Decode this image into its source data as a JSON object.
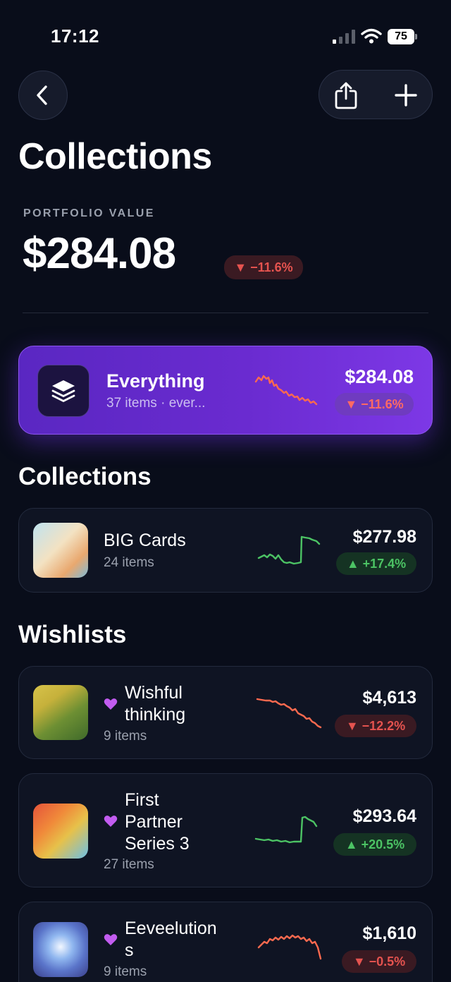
{
  "status_bar": {
    "time": "17:12",
    "battery": "75"
  },
  "header": {
    "title": "Collections"
  },
  "portfolio": {
    "label": "PORTFOLIO VALUE",
    "value": "$284.08",
    "change": "▼ −11.6%"
  },
  "everything": {
    "name": "Everything",
    "subtitle": "37 items · ever...",
    "value": "$284.08",
    "change": "▼ −11.6%"
  },
  "collections_section": {
    "title": "Collections",
    "items": [
      {
        "name": "BIG Cards",
        "count": "24 items",
        "value": "$277.98",
        "change": "▲ +17.4%",
        "trend": "up"
      }
    ]
  },
  "wishlists_section": {
    "title": "Wishlists",
    "items": [
      {
        "name": "Wishful thinking",
        "count": "9 items",
        "value": "$4,613",
        "change": "▼ −12.2%",
        "trend": "down",
        "icon": "heart-icon"
      },
      {
        "name": "First Partner Series 3",
        "count": "27 items",
        "value": "$293.64",
        "change": "▲ +20.5%",
        "trend": "up",
        "icon": "heart-icon"
      },
      {
        "name": "Eeveelutions",
        "count": "9 items",
        "value": "$1,610",
        "change": "▼ −0.5%",
        "trend": "down",
        "icon": "heart-icon"
      }
    ]
  },
  "colors": {
    "background": "#090d1a",
    "accent": "#6a2bd0",
    "down": "#e5534f",
    "up": "#4cc364",
    "heart": "#c25cf0"
  }
}
